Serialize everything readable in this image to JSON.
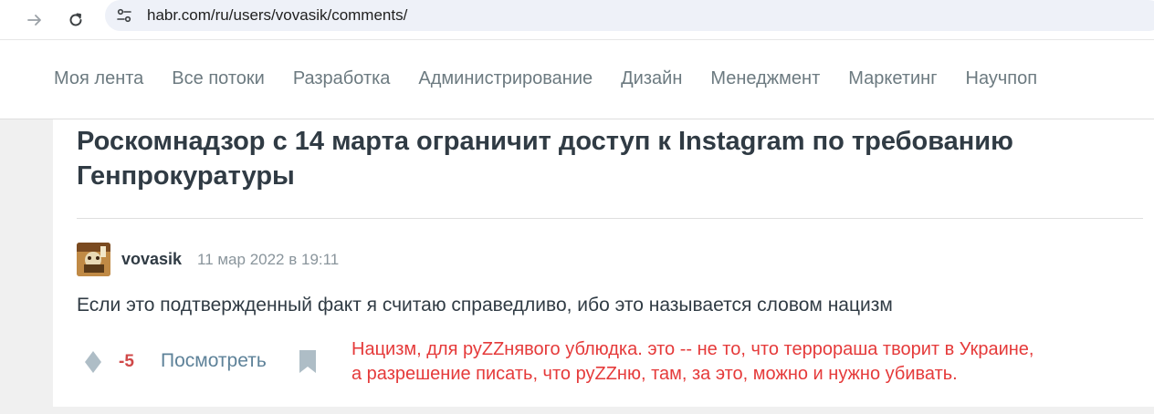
{
  "browser": {
    "url": "habr.com/ru/users/vovasik/comments/"
  },
  "nav": {
    "items": [
      "Моя лента",
      "Все потоки",
      "Разработка",
      "Администрирование",
      "Дизайн",
      "Менеджмент",
      "Маркетинг",
      "Научпоп"
    ]
  },
  "article": {
    "title": "Роскомнадзор с 14 марта ограничит доступ к Instagram по требованию Генпрокуратуры"
  },
  "comment": {
    "author": "vovasik",
    "timestamp": "11 мар 2022 в 19:11",
    "text": "Если это подтвержденный факт я считаю справедливо, ибо это называется словом нацизм",
    "score": "-5",
    "view_label": "Посмотреть"
  },
  "annotation": {
    "line1": "Нацизм, для руZZнявого ублюдка. это -- не то, что террораша творит в Украине,",
    "line2": "а разрешение писать, что руZZню, там, за это, можно и нужно убивать."
  },
  "colors": {
    "score_negative": "#d04848",
    "annotation": "#e53a3a",
    "link": "#5e8299"
  }
}
